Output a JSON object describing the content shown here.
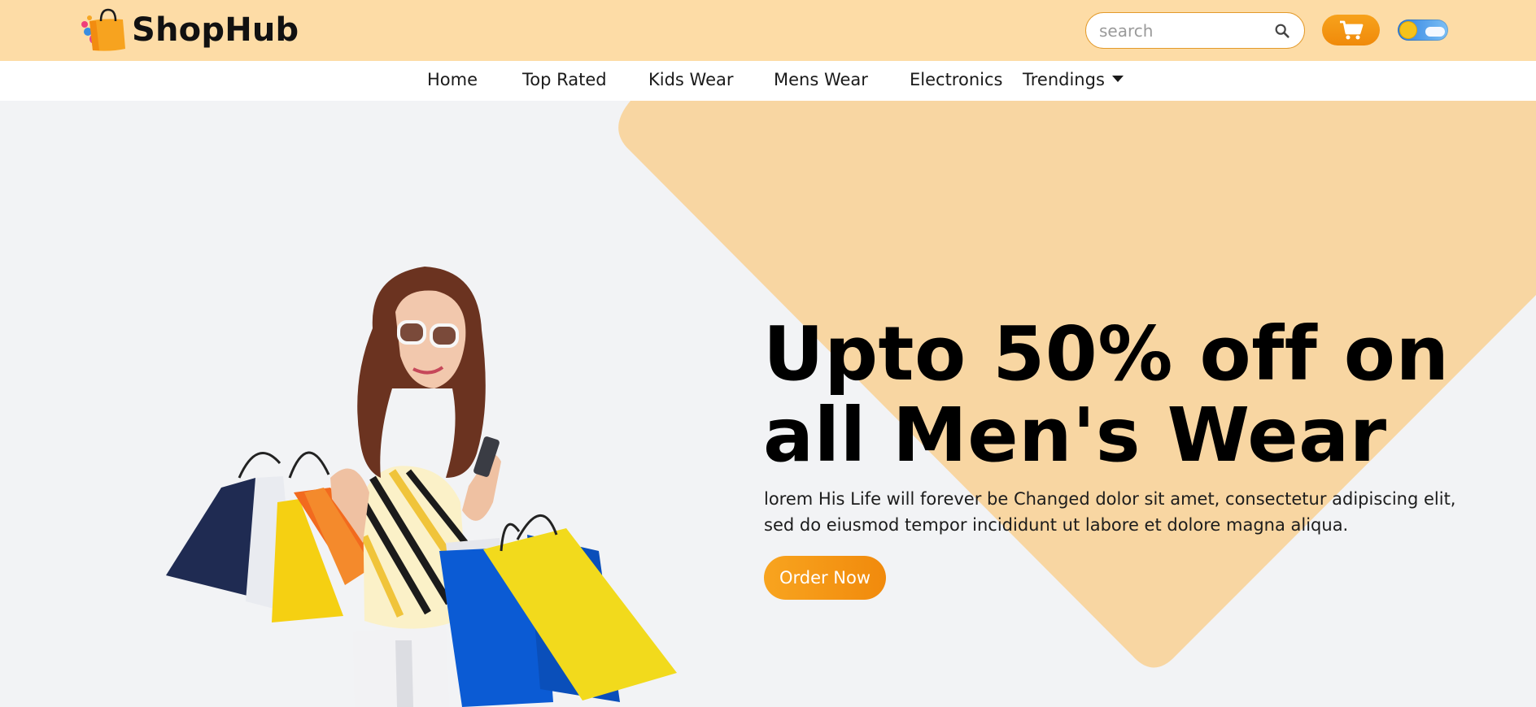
{
  "brand": {
    "name": "ShopHub",
    "logo_icon": "shopping-bag-icon"
  },
  "header": {
    "search": {
      "placeholder": "search",
      "value": "",
      "icon": "search-icon"
    },
    "cart_icon": "cart-icon",
    "theme_toggle": {
      "state": "light",
      "icon": "sun-icon"
    }
  },
  "nav": {
    "items": [
      {
        "label": "Home"
      },
      {
        "label": "Top Rated"
      },
      {
        "label": "Kids Wear"
      },
      {
        "label": "Mens Wear"
      },
      {
        "label": "Electronics"
      },
      {
        "label": "Trendings",
        "has_dropdown": true
      }
    ]
  },
  "hero": {
    "headline_line1": "Upto 50% off on",
    "headline_line2": "all Men's Wear",
    "description": "lorem His Life will forever be Changed dolor sit amet, consectetur adipiscing elit, sed do eiusmod tempor incididunt ut labore et dolore magna aliqua.",
    "cta_label": "Order Now",
    "image": "woman-with-shopping-bags"
  },
  "colors": {
    "header_bg": "#fddca6",
    "accent": "#f4961a",
    "hero_shape": "#f8d6a2",
    "hero_bg": "#f2f3f5"
  }
}
